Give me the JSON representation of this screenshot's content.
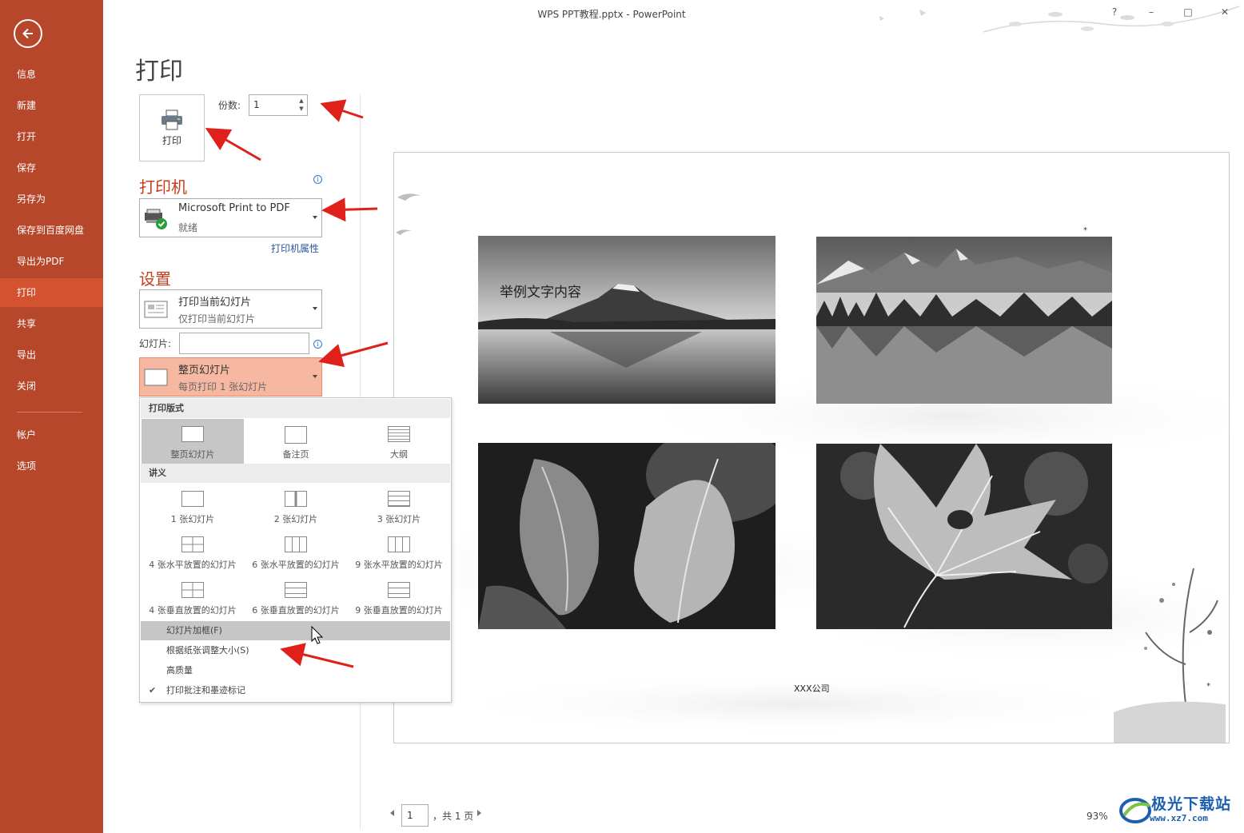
{
  "window": {
    "title": "WPS PPT教程.pptx - PowerPoint",
    "help": "?",
    "minimize": "–",
    "maximize": "□",
    "close": "✕"
  },
  "sidebar": {
    "items": [
      {
        "label": "信息"
      },
      {
        "label": "新建"
      },
      {
        "label": "打开"
      },
      {
        "label": "保存"
      },
      {
        "label": "另存为"
      },
      {
        "label": "保存到百度网盘"
      },
      {
        "label": "导出为PDF"
      },
      {
        "label": "打印",
        "active": true
      },
      {
        "label": "共享"
      },
      {
        "label": "导出"
      },
      {
        "label": "关闭"
      },
      {
        "label": "帐户"
      },
      {
        "label": "选项"
      }
    ],
    "accent": "#b7472a",
    "active_color": "#d35230"
  },
  "page": {
    "title": "打印"
  },
  "print_button": {
    "label": "打印"
  },
  "copies": {
    "label": "份数:",
    "value": "1"
  },
  "printer": {
    "heading": "打印机",
    "name": "Microsoft Print to PDF",
    "status": "就绪",
    "properties_link": "打印机属性"
  },
  "settings": {
    "heading": "设置",
    "range_main": "打印当前幻灯片",
    "range_sub": "仅打印当前幻灯片",
    "slides_label": "幻灯片:",
    "slides_value": "",
    "layout_main": "整页幻灯片",
    "layout_sub": "每页打印 1 张幻灯片"
  },
  "popup": {
    "group_layout": "打印版式",
    "layouts": [
      "整页幻灯片",
      "备注页",
      "大纲"
    ],
    "group_handouts": "讲义",
    "handouts": [
      "1 张幻灯片",
      "2 张幻灯片",
      "3 张幻灯片",
      "4 张水平放置的幻灯片",
      "6 张水平放置的幻灯片",
      "9 张水平放置的幻灯片",
      "4 张垂直放置的幻灯片",
      "6 张垂直放置的幻灯片",
      "9 张垂直放置的幻灯片"
    ],
    "options": [
      {
        "label": "幻灯片加框(F)",
        "checked": false
      },
      {
        "label": "根据纸张调整大小(S)",
        "checked": false
      },
      {
        "label": "高质量",
        "checked": false
      },
      {
        "label": "打印批注和墨迹标记",
        "checked": true
      }
    ]
  },
  "preview": {
    "slide_text": "举例文字内容",
    "company": "XXX公司",
    "star": "*"
  },
  "pagination": {
    "current": "1",
    "total": "，共 1 页",
    "zoom": "93%"
  },
  "watermark": {
    "brand": "极光下载站",
    "url": "www.xz7.com"
  }
}
